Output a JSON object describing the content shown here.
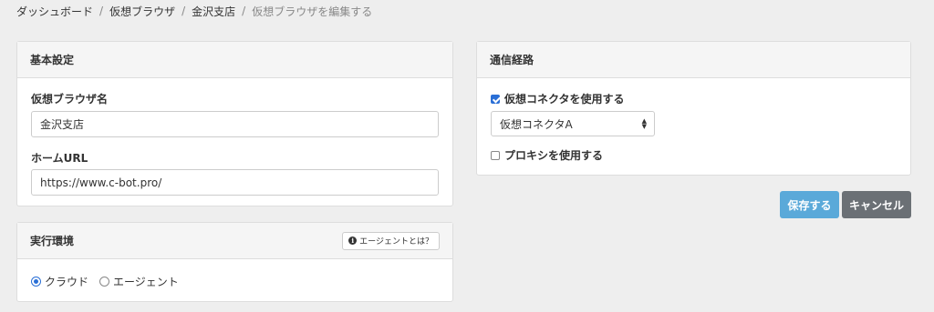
{
  "breadcrumb": {
    "items": [
      "ダッシュボード",
      "仮想ブラウザ",
      "金沢支店"
    ],
    "current": "仮想ブラウザを編集する",
    "separator": "/"
  },
  "basic_settings": {
    "title": "基本設定",
    "name_label": "仮想ブラウザ名",
    "name_value": "金沢支店",
    "url_label": "ホームURL",
    "url_value": "https://www.c-bot.pro/"
  },
  "execution_env": {
    "title": "実行環境",
    "help_button": "エージェントとは？",
    "options": [
      "クラウド",
      "エージェント"
    ],
    "selected": "クラウド"
  },
  "route": {
    "title": "通信経路",
    "use_connector_label": "仮想コネクタを使用する",
    "use_connector_checked": true,
    "connector_selected": "仮想コネクタA",
    "use_proxy_label": "プロキシを使用する",
    "use_proxy_checked": false
  },
  "actions": {
    "save": "保存する",
    "cancel": "キャンセル"
  },
  "colors": {
    "primary": "#5aa9d9",
    "secondary": "#6b7075",
    "check": "#2a6fd6"
  }
}
